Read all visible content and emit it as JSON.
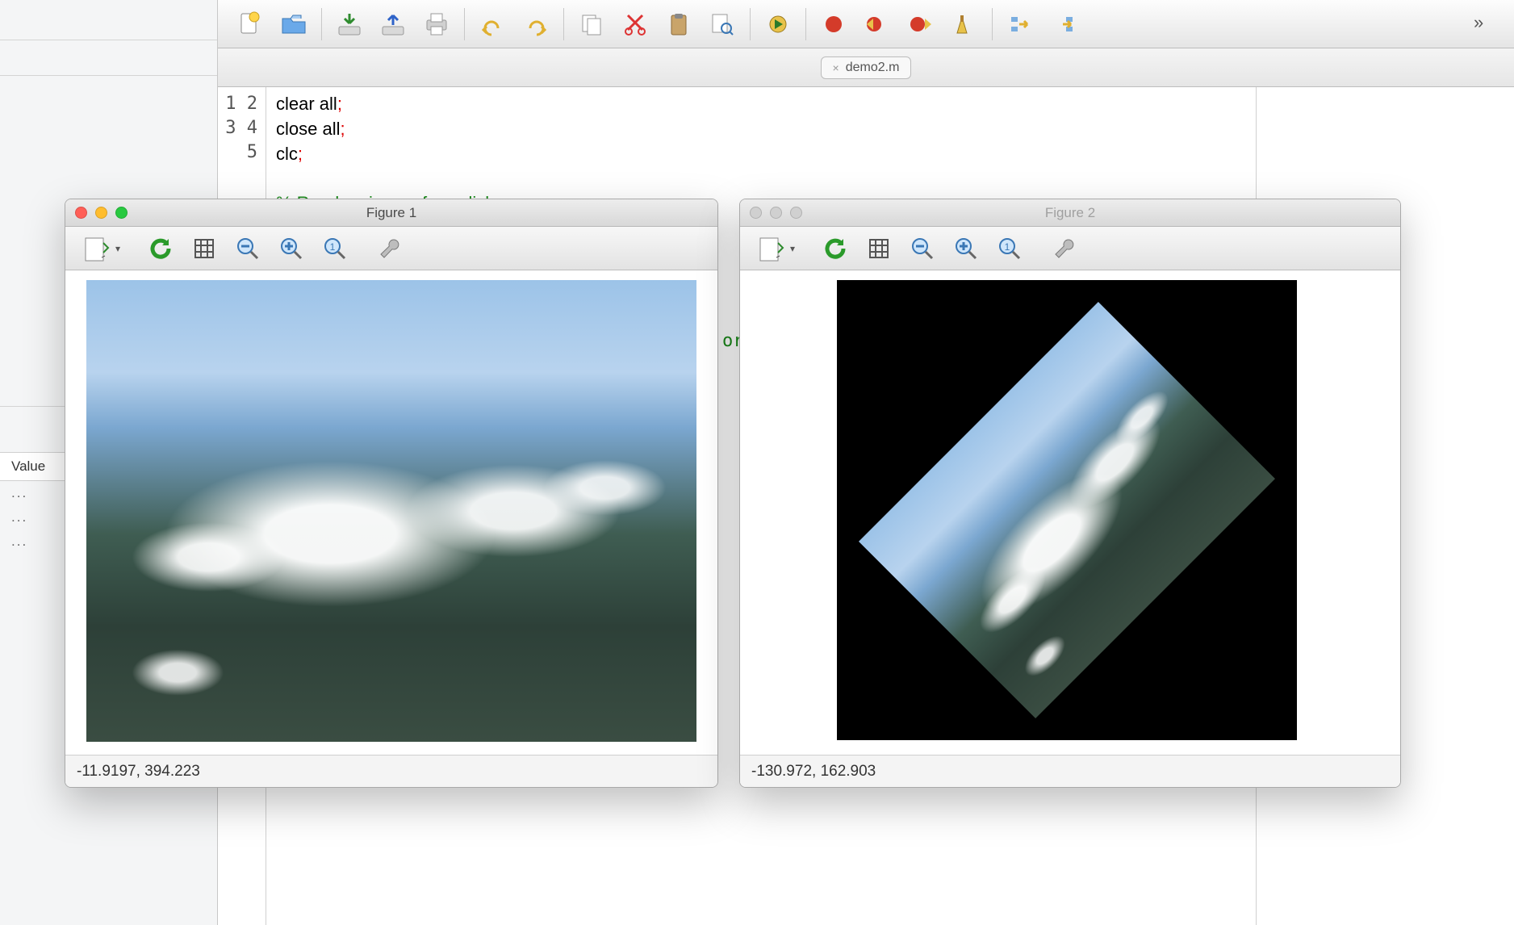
{
  "ide": {
    "tab": {
      "filename": "demo2.m",
      "close_glyph": "×"
    },
    "toolbar_more_glyph": "»",
    "code": {
      "lines": [
        {
          "n": "1",
          "segments": [
            {
              "t": "clear all",
              "cls": "kw"
            },
            {
              "t": ";",
              "cls": "pun"
            }
          ]
        },
        {
          "n": "2",
          "segments": [
            {
              "t": "close all",
              "cls": "kw"
            },
            {
              "t": ";",
              "cls": "pun"
            }
          ]
        },
        {
          "n": "3",
          "segments": [
            {
              "t": "clc",
              "cls": "kw"
            },
            {
              "t": ";",
              "cls": "pun"
            }
          ]
        },
        {
          "n": "4",
          "segments": []
        },
        {
          "n": "5",
          "segments": [
            {
              "t": "% Read an image from disk",
              "cls": "com"
            }
          ]
        }
      ]
    },
    "peek_text": "ori",
    "workspace": {
      "header": "Value",
      "rows": [
        "...",
        "...",
        "..."
      ]
    }
  },
  "figure1": {
    "title": "Figure 1",
    "status": "-11.9197, 394.223",
    "active": true
  },
  "figure2": {
    "title": "Figure 2",
    "status": "-130.972, 162.903",
    "active": false
  },
  "fig_tool_names": [
    "save-icon",
    "refresh-icon",
    "grid-icon",
    "zoom-out-icon",
    "zoom-in-icon",
    "zoom-reset-icon",
    "wrench-icon"
  ]
}
